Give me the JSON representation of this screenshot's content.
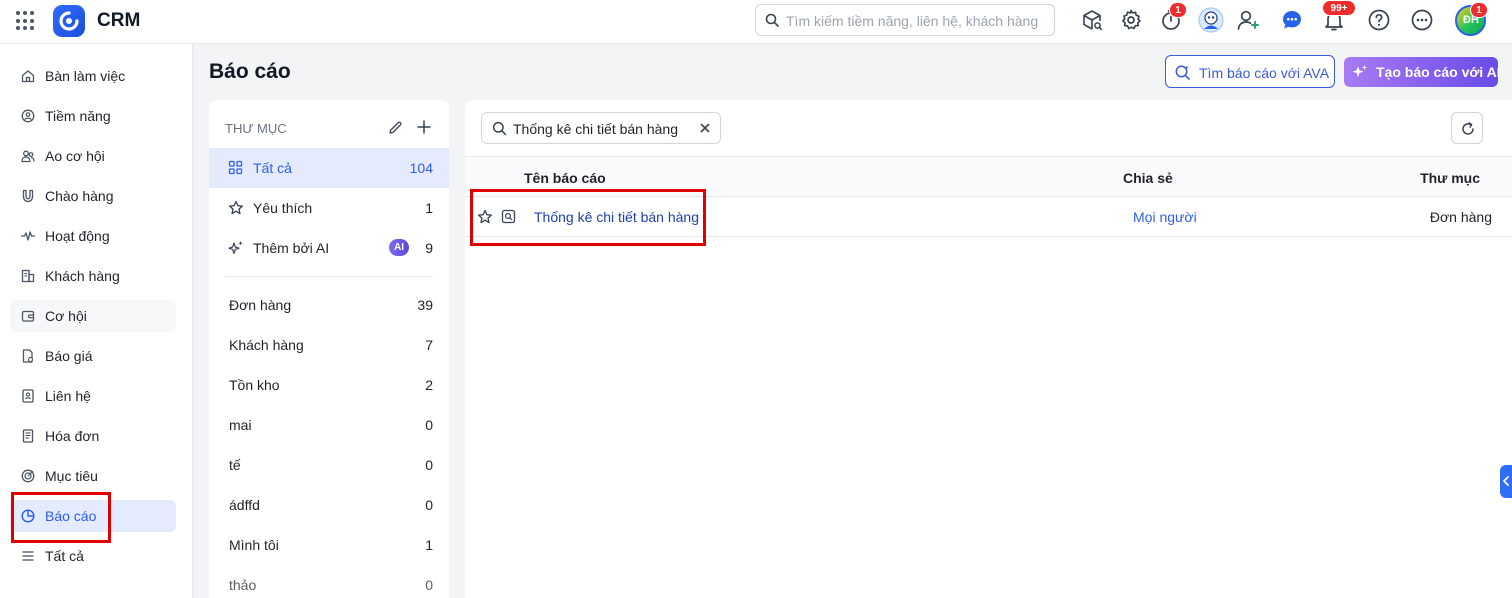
{
  "app": {
    "title": "CRM",
    "brand_color": "#2f6bff"
  },
  "topbar": {
    "search_placeholder": "Tìm kiếm tiềm năng, liên hệ, khách hàng",
    "icons": [
      "package-search-icon",
      "gear-icon",
      "timer-icon",
      "character-avatar-icon",
      "add-user-icon",
      "chat-icon",
      "bell-icon",
      "help-icon",
      "more-icon",
      "user-avatar"
    ],
    "timer_badge": "1",
    "bell_badge": "99+",
    "avatar_initials": "ĐH",
    "avatar_badge": "1"
  },
  "sidebar": {
    "items": [
      {
        "label": "Bàn làm việc",
        "icon": "home-icon"
      },
      {
        "label": "Tiềm năng",
        "icon": "target-user-icon"
      },
      {
        "label": "Ao cơ hội",
        "icon": "people-icon"
      },
      {
        "label": "Chào hàng",
        "icon": "magnet-icon"
      },
      {
        "label": "Hoạt động",
        "icon": "activity-icon"
      },
      {
        "label": "Khách hàng",
        "icon": "building-icon"
      },
      {
        "label": "Cơ hội",
        "icon": "wallet-icon"
      },
      {
        "label": "Báo giá",
        "icon": "quote-file-icon"
      },
      {
        "label": "Liên hệ",
        "icon": "contact-book-icon"
      },
      {
        "label": "Hóa đơn",
        "icon": "invoice-icon"
      },
      {
        "label": "Mục tiêu",
        "icon": "goal-icon"
      },
      {
        "label": "Báo cáo",
        "icon": "pie-chart-icon",
        "active": true
      },
      {
        "label": "Tất cả",
        "icon": "menu-icon"
      }
    ]
  },
  "page": {
    "title": "Báo cáo",
    "btn_find_ava": "Tìm báo cáo với AVA",
    "btn_create_ai": "Tạo báo cáo với AI"
  },
  "folders": {
    "header": "THƯ MỤC",
    "top": [
      {
        "label": "Tất cả",
        "count": "104",
        "icon": "grid-icon",
        "active": true
      },
      {
        "label": "Yêu thích",
        "count": "1",
        "icon": "star-icon"
      },
      {
        "label": "Thêm bởi AI",
        "count": "9",
        "icon": "sparkle-icon",
        "badge": "AI"
      }
    ],
    "list": [
      {
        "label": "Đơn hàng",
        "count": "39"
      },
      {
        "label": "Khách hàng",
        "count": "7"
      },
      {
        "label": "Tồn kho",
        "count": "2"
      },
      {
        "label": "mai",
        "count": "0"
      },
      {
        "label": "tế",
        "count": "0"
      },
      {
        "label": "ádffd",
        "count": "0"
      },
      {
        "label": "Mình tôi",
        "count": "1"
      },
      {
        "label": "thảo",
        "count": "0"
      }
    ]
  },
  "reports": {
    "search_value": "Thống kê chi tiết bán hàng",
    "columns": {
      "name": "Tên báo cáo",
      "share": "Chia sẻ",
      "folder": "Thư mục"
    },
    "rows": [
      {
        "name": "Thống kê chi tiết bán hàng",
        "share": "Mọi người",
        "folder": "Đơn hàng"
      }
    ]
  },
  "colors": {
    "accent": "#2e5cf6",
    "active_bg": "#e5ebff",
    "highlight": "#e00000",
    "ai_gradient_start": "#a77bf3",
    "ai_gradient_end": "#6a4be8"
  }
}
